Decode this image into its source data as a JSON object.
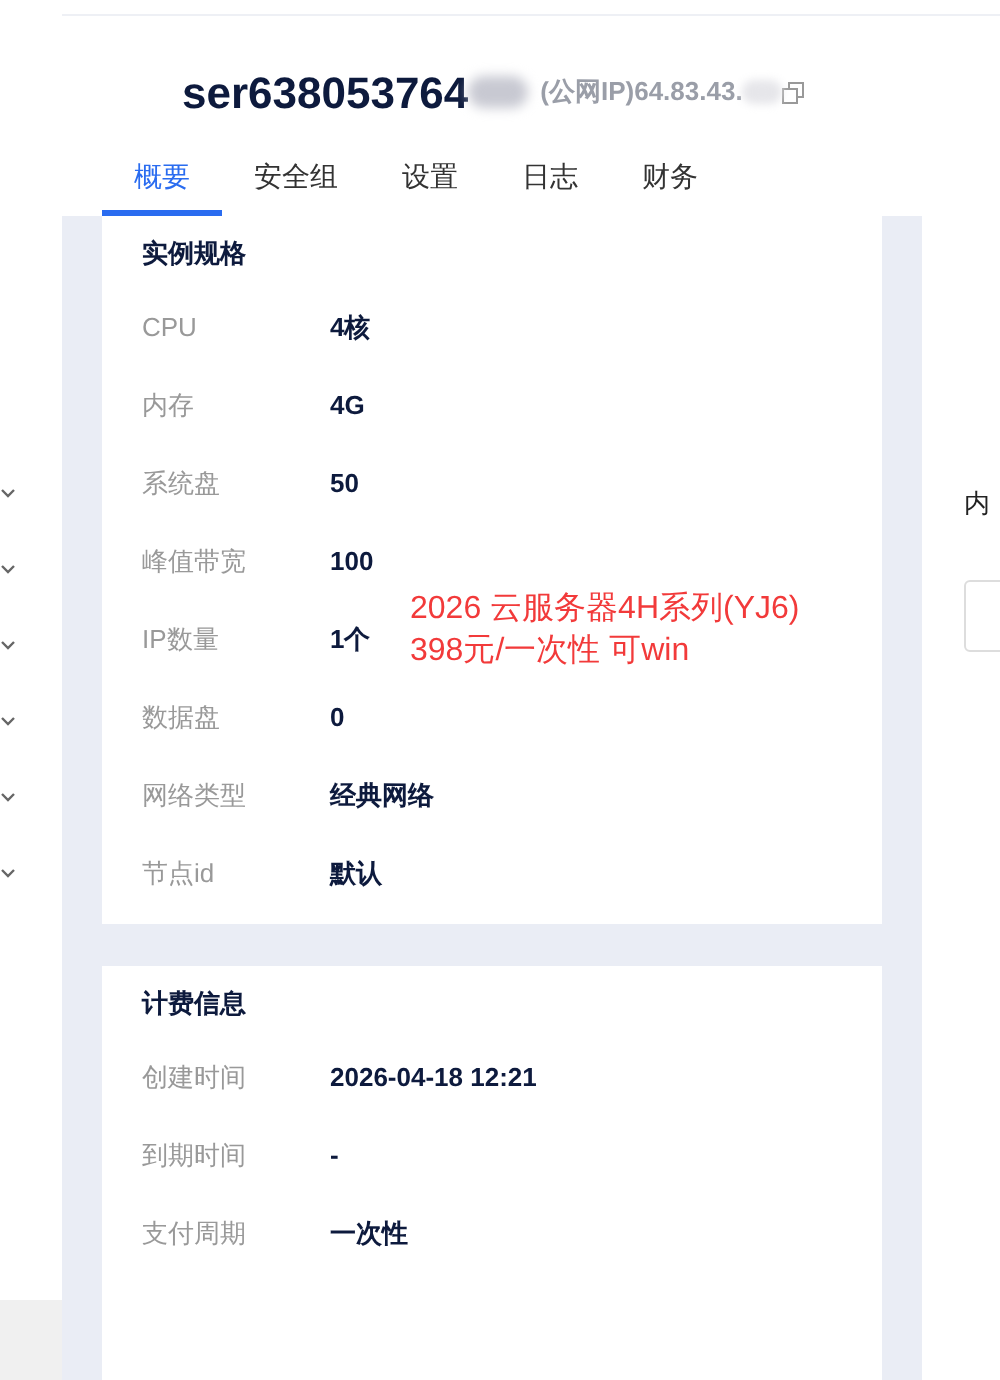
{
  "header": {
    "title": "ser638053764",
    "ip": "(公网IP)64.83.43."
  },
  "tabs": [
    {
      "label": "概要",
      "selected": true
    },
    {
      "label": "安全组",
      "selected": false
    },
    {
      "label": "设置",
      "selected": false
    },
    {
      "label": "日志",
      "selected": false
    },
    {
      "label": "财务",
      "selected": false
    }
  ],
  "sections": [
    {
      "title": "实例规格",
      "rows": [
        {
          "label": "CPU",
          "value": "4核"
        },
        {
          "label": "内存",
          "value": "4G"
        },
        {
          "label": "系统盘",
          "value": "50"
        },
        {
          "label": "峰值带宽",
          "value": "100"
        },
        {
          "label": "IP数量",
          "value": "1个"
        },
        {
          "label": "数据盘",
          "value": "0"
        },
        {
          "label": "网络类型",
          "value": "经典网络"
        },
        {
          "label": "节点id",
          "value": "默认"
        }
      ]
    },
    {
      "title": "计费信息",
      "rows": [
        {
          "label": "创建时间",
          "value": "2026-04-18 12:21"
        },
        {
          "label": "到期时间",
          "value": "-"
        },
        {
          "label": "支付周期",
          "value": "一次性"
        }
      ]
    }
  ],
  "annotation": [
    "2026 云服务器4H系列(YJ6)",
    "398元/一次性 可win"
  ],
  "right_panel": {
    "label": "内"
  }
}
